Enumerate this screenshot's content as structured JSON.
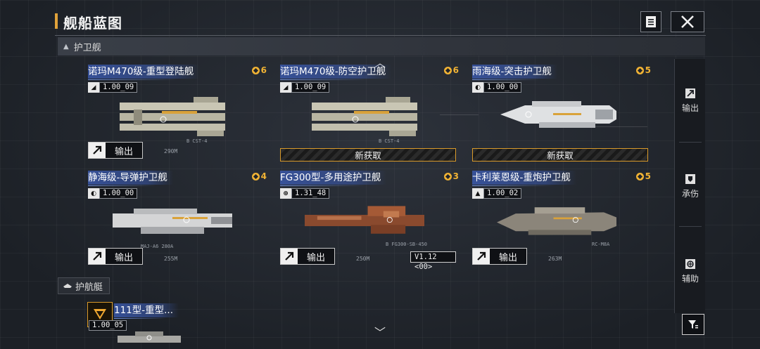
{
  "header": {
    "title": "舰船蓝图"
  },
  "section": {
    "label": "护卫舰"
  },
  "export_label": "输出",
  "new_label": "新获取",
  "cards": [
    {
      "name": "诺玛M470级-重型登陆舰",
      "cost": "6",
      "version": "1.00_09",
      "ship_code": "B CST-4",
      "scale": "290M",
      "state": "export"
    },
    {
      "name": "诺玛M470级-防空护卫舰",
      "cost": "6",
      "version": "1.00_09",
      "ship_code": "B CST-4",
      "scale": "",
      "state": "new"
    },
    {
      "name": "雨海级-突击护卫舰",
      "cost": "5",
      "version": "1.00_00",
      "ship_code": "",
      "scale": "",
      "state": "new"
    },
    {
      "name": "静海级-导弹护卫舰",
      "cost": "4",
      "version": "1.00_00",
      "ship_code": "MAJ-A6 280A",
      "scale": "255M",
      "state": "export"
    },
    {
      "name": "FG300型-多用途护卫舰",
      "cost": "3",
      "version": "1.31_48",
      "ship_code": "B FG300-SB-450",
      "scale": "250M",
      "state": "export",
      "ver_tag": "V1.12 <00>"
    },
    {
      "name": "卡利莱恩级-重炮护卫舰",
      "cost": "5",
      "version": "1.00_02",
      "ship_code": "RC-M8A",
      "scale": "263M",
      "state": "export"
    }
  ],
  "side_panel": [
    {
      "label": "输出",
      "icon": "export-icon"
    },
    {
      "label": "承伤",
      "icon": "shield-icon"
    },
    {
      "label": "辅助",
      "icon": "support-icon"
    }
  ],
  "section2": {
    "label": "护航艇"
  },
  "partial_card": {
    "name": "111型-重型...",
    "version": "1.00_05"
  },
  "colors": {
    "accent": "#e0a23a",
    "name_bar": "#3a58aa",
    "cost": "#f0b234"
  }
}
